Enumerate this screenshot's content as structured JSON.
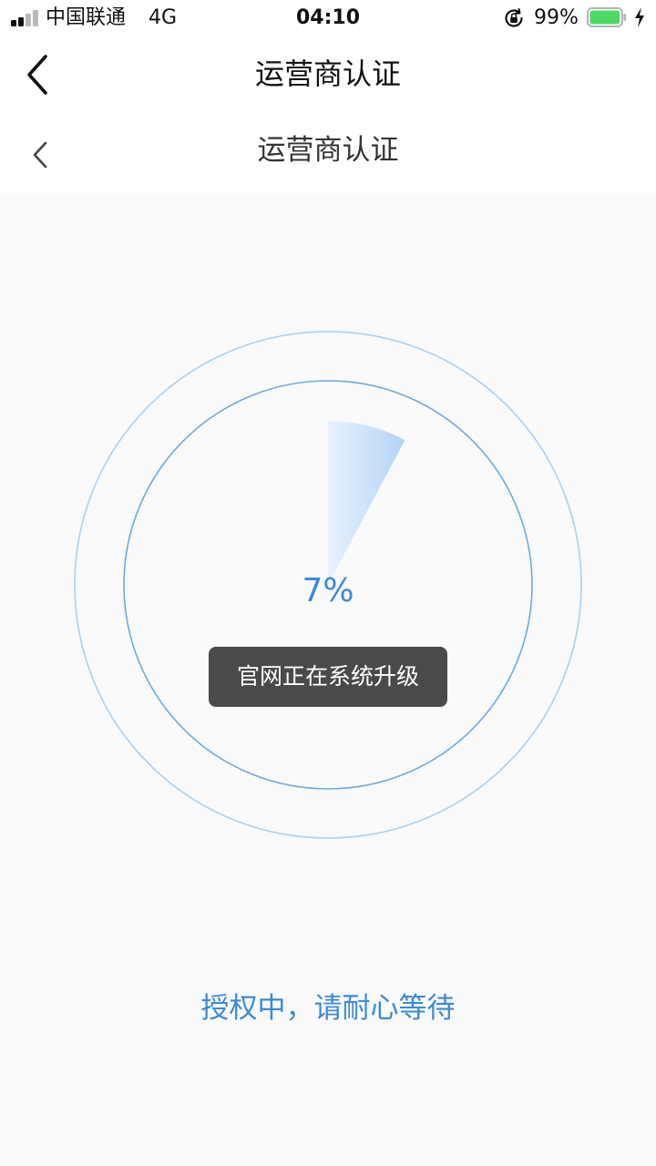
{
  "status_bar": {
    "carrier": "中国联通",
    "network": "4G",
    "time": "04:10",
    "battery_percent": "99%",
    "battery_level": 0.99,
    "battery_color": "#4cd964",
    "icons": [
      "signal-icon",
      "rotation-lock-icon",
      "battery-icon",
      "charging-bolt-icon"
    ]
  },
  "nav": {
    "title": "运营商认证",
    "back_icon": "chevron-left-icon"
  },
  "subnav": {
    "title": "运营商认证",
    "back_icon": "chevron-left-icon"
  },
  "progress": {
    "percent_label": "7%",
    "value": 0.07,
    "toast": "官网正在系统升级",
    "status": "授权中，请耐心等待",
    "accent_color": "#3b8ad8"
  }
}
